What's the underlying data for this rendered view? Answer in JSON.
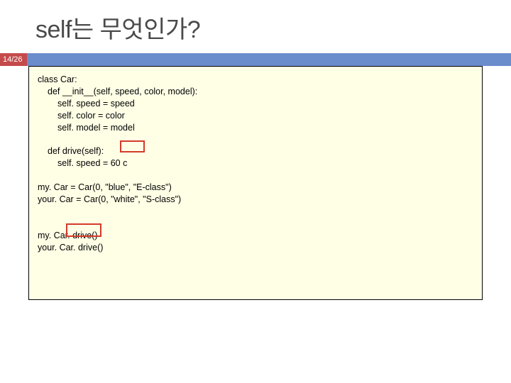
{
  "title": "self는 무엇인가?",
  "slide_number": "14/26",
  "code": {
    "l1": "class Car:",
    "l2": "def __init__(self, speed, color, model):",
    "l3": "self. speed = speed",
    "l4": "self. color = color",
    "l5": "self. model = model",
    "l6": "def drive(self):",
    "l7": "self. speed = 60 c",
    "l8": "my. Car = Car(0, \"blue\", \"E-class\")",
    "l9": "your. Car = Car(0, \"white\", \"S-class\")",
    "l10": "my. Car. drive()",
    "l11": "your. Car. drive()"
  }
}
